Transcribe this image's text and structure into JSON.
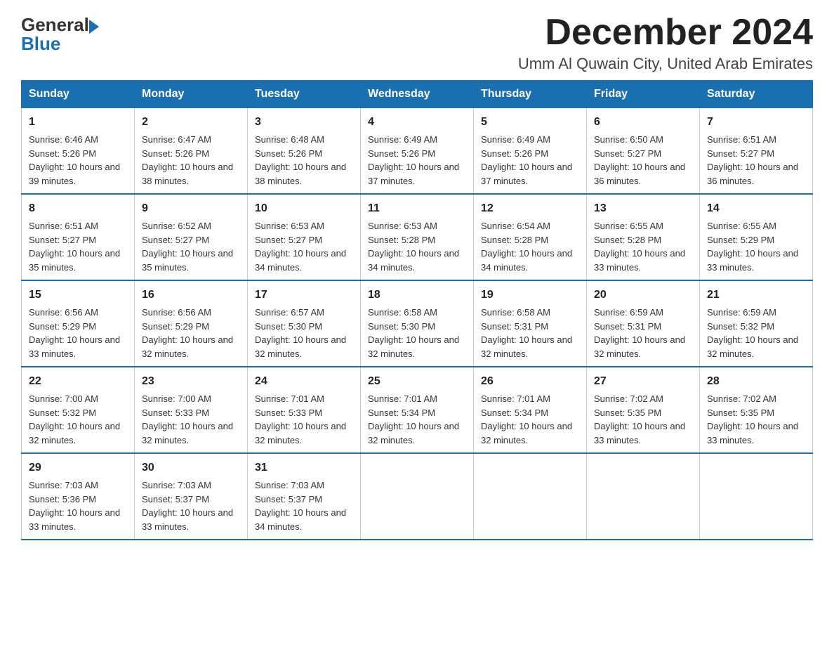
{
  "logo": {
    "text_general": "General",
    "text_blue": "Blue"
  },
  "header": {
    "month_year": "December 2024",
    "location": "Umm Al Quwain City, United Arab Emirates"
  },
  "days_of_week": [
    "Sunday",
    "Monday",
    "Tuesday",
    "Wednesday",
    "Thursday",
    "Friday",
    "Saturday"
  ],
  "weeks": [
    [
      {
        "day": "1",
        "sunrise": "Sunrise: 6:46 AM",
        "sunset": "Sunset: 5:26 PM",
        "daylight": "Daylight: 10 hours and 39 minutes."
      },
      {
        "day": "2",
        "sunrise": "Sunrise: 6:47 AM",
        "sunset": "Sunset: 5:26 PM",
        "daylight": "Daylight: 10 hours and 38 minutes."
      },
      {
        "day": "3",
        "sunrise": "Sunrise: 6:48 AM",
        "sunset": "Sunset: 5:26 PM",
        "daylight": "Daylight: 10 hours and 38 minutes."
      },
      {
        "day": "4",
        "sunrise": "Sunrise: 6:49 AM",
        "sunset": "Sunset: 5:26 PM",
        "daylight": "Daylight: 10 hours and 37 minutes."
      },
      {
        "day": "5",
        "sunrise": "Sunrise: 6:49 AM",
        "sunset": "Sunset: 5:26 PM",
        "daylight": "Daylight: 10 hours and 37 minutes."
      },
      {
        "day": "6",
        "sunrise": "Sunrise: 6:50 AM",
        "sunset": "Sunset: 5:27 PM",
        "daylight": "Daylight: 10 hours and 36 minutes."
      },
      {
        "day": "7",
        "sunrise": "Sunrise: 6:51 AM",
        "sunset": "Sunset: 5:27 PM",
        "daylight": "Daylight: 10 hours and 36 minutes."
      }
    ],
    [
      {
        "day": "8",
        "sunrise": "Sunrise: 6:51 AM",
        "sunset": "Sunset: 5:27 PM",
        "daylight": "Daylight: 10 hours and 35 minutes."
      },
      {
        "day": "9",
        "sunrise": "Sunrise: 6:52 AM",
        "sunset": "Sunset: 5:27 PM",
        "daylight": "Daylight: 10 hours and 35 minutes."
      },
      {
        "day": "10",
        "sunrise": "Sunrise: 6:53 AM",
        "sunset": "Sunset: 5:27 PM",
        "daylight": "Daylight: 10 hours and 34 minutes."
      },
      {
        "day": "11",
        "sunrise": "Sunrise: 6:53 AM",
        "sunset": "Sunset: 5:28 PM",
        "daylight": "Daylight: 10 hours and 34 minutes."
      },
      {
        "day": "12",
        "sunrise": "Sunrise: 6:54 AM",
        "sunset": "Sunset: 5:28 PM",
        "daylight": "Daylight: 10 hours and 34 minutes."
      },
      {
        "day": "13",
        "sunrise": "Sunrise: 6:55 AM",
        "sunset": "Sunset: 5:28 PM",
        "daylight": "Daylight: 10 hours and 33 minutes."
      },
      {
        "day": "14",
        "sunrise": "Sunrise: 6:55 AM",
        "sunset": "Sunset: 5:29 PM",
        "daylight": "Daylight: 10 hours and 33 minutes."
      }
    ],
    [
      {
        "day": "15",
        "sunrise": "Sunrise: 6:56 AM",
        "sunset": "Sunset: 5:29 PM",
        "daylight": "Daylight: 10 hours and 33 minutes."
      },
      {
        "day": "16",
        "sunrise": "Sunrise: 6:56 AM",
        "sunset": "Sunset: 5:29 PM",
        "daylight": "Daylight: 10 hours and 32 minutes."
      },
      {
        "day": "17",
        "sunrise": "Sunrise: 6:57 AM",
        "sunset": "Sunset: 5:30 PM",
        "daylight": "Daylight: 10 hours and 32 minutes."
      },
      {
        "day": "18",
        "sunrise": "Sunrise: 6:58 AM",
        "sunset": "Sunset: 5:30 PM",
        "daylight": "Daylight: 10 hours and 32 minutes."
      },
      {
        "day": "19",
        "sunrise": "Sunrise: 6:58 AM",
        "sunset": "Sunset: 5:31 PM",
        "daylight": "Daylight: 10 hours and 32 minutes."
      },
      {
        "day": "20",
        "sunrise": "Sunrise: 6:59 AM",
        "sunset": "Sunset: 5:31 PM",
        "daylight": "Daylight: 10 hours and 32 minutes."
      },
      {
        "day": "21",
        "sunrise": "Sunrise: 6:59 AM",
        "sunset": "Sunset: 5:32 PM",
        "daylight": "Daylight: 10 hours and 32 minutes."
      }
    ],
    [
      {
        "day": "22",
        "sunrise": "Sunrise: 7:00 AM",
        "sunset": "Sunset: 5:32 PM",
        "daylight": "Daylight: 10 hours and 32 minutes."
      },
      {
        "day": "23",
        "sunrise": "Sunrise: 7:00 AM",
        "sunset": "Sunset: 5:33 PM",
        "daylight": "Daylight: 10 hours and 32 minutes."
      },
      {
        "day": "24",
        "sunrise": "Sunrise: 7:01 AM",
        "sunset": "Sunset: 5:33 PM",
        "daylight": "Daylight: 10 hours and 32 minutes."
      },
      {
        "day": "25",
        "sunrise": "Sunrise: 7:01 AM",
        "sunset": "Sunset: 5:34 PM",
        "daylight": "Daylight: 10 hours and 32 minutes."
      },
      {
        "day": "26",
        "sunrise": "Sunrise: 7:01 AM",
        "sunset": "Sunset: 5:34 PM",
        "daylight": "Daylight: 10 hours and 32 minutes."
      },
      {
        "day": "27",
        "sunrise": "Sunrise: 7:02 AM",
        "sunset": "Sunset: 5:35 PM",
        "daylight": "Daylight: 10 hours and 33 minutes."
      },
      {
        "day": "28",
        "sunrise": "Sunrise: 7:02 AM",
        "sunset": "Sunset: 5:35 PM",
        "daylight": "Daylight: 10 hours and 33 minutes."
      }
    ],
    [
      {
        "day": "29",
        "sunrise": "Sunrise: 7:03 AM",
        "sunset": "Sunset: 5:36 PM",
        "daylight": "Daylight: 10 hours and 33 minutes."
      },
      {
        "day": "30",
        "sunrise": "Sunrise: 7:03 AM",
        "sunset": "Sunset: 5:37 PM",
        "daylight": "Daylight: 10 hours and 33 minutes."
      },
      {
        "day": "31",
        "sunrise": "Sunrise: 7:03 AM",
        "sunset": "Sunset: 5:37 PM",
        "daylight": "Daylight: 10 hours and 34 minutes."
      },
      null,
      null,
      null,
      null
    ]
  ]
}
